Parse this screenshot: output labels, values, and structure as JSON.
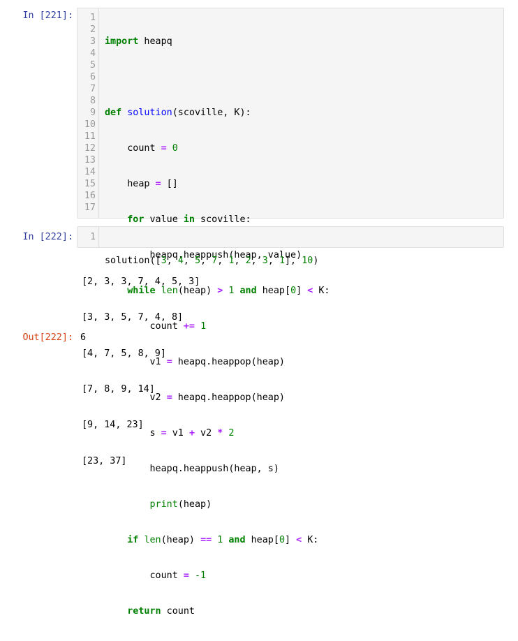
{
  "cell1": {
    "prompt": "In [221]:",
    "line_numbers": [
      "1",
      "2",
      "3",
      "4",
      "5",
      "6",
      "7",
      "8",
      "9",
      "10",
      "11",
      "12",
      "13",
      "14",
      "15",
      "16",
      "17"
    ],
    "tokens": {
      "l1_kw": "import",
      "l1_rest": " heapq",
      "l3_kw": "def",
      "l3_fn": "solution",
      "l3_rest": "(scoville, K):",
      "l4_a": "    count ",
      "l4_op": "=",
      "l4_sp": " ",
      "l4_num": "0",
      "l5_a": "    heap ",
      "l5_op": "=",
      "l5_rest": " []",
      "l6_sp": "    ",
      "l6_kw1": "for",
      "l6_mid": " value ",
      "l6_kw2": "in",
      "l6_rest": " scoville:",
      "l7": "        heapq.heappush(heap, value)",
      "l8_sp": "    ",
      "l8_kw": "while",
      "l8_sp2": " ",
      "l8_bi": "len",
      "l8_a": "(heap) ",
      "l8_op1": ">",
      "l8_sp3": " ",
      "l8_num1": "1",
      "l8_sp4": " ",
      "l8_kw2": "and",
      "l8_b": " heap[",
      "l8_num2": "0",
      "l8_c": "] ",
      "l8_op2": "<",
      "l8_d": " K:",
      "l9_a": "        count ",
      "l9_op": "+=",
      "l9_sp": " ",
      "l9_num": "1",
      "l10_a": "        v1 ",
      "l10_op": "=",
      "l10_rest": " heapq.heappop(heap)",
      "l11_a": "        v2 ",
      "l11_op": "=",
      "l11_rest": " heapq.heappop(heap)",
      "l12_a": "        s ",
      "l12_op1": "=",
      "l12_b": " v1 ",
      "l12_op2": "+",
      "l12_c": " v2 ",
      "l12_op3": "*",
      "l12_sp": " ",
      "l12_num": "2",
      "l13": "        heapq.heappush(heap, s)",
      "l14_sp": "        ",
      "l14_bi": "print",
      "l14_rest": "(heap)",
      "l15_sp": "    ",
      "l15_kw": "if",
      "l15_sp2": " ",
      "l15_bi": "len",
      "l15_a": "(heap) ",
      "l15_op": "==",
      "l15_sp3": " ",
      "l15_num1": "1",
      "l15_sp4": " ",
      "l15_kw2": "and",
      "l15_b": " heap[",
      "l15_num2": "0",
      "l15_c": "] ",
      "l15_op2": "<",
      "l15_d": " K:",
      "l16_a": "        count ",
      "l16_op": "=",
      "l16_sp": " ",
      "l16_num": "-1",
      "l17_sp": "    ",
      "l17_kw": "return",
      "l17_rest": " count"
    }
  },
  "cell2": {
    "prompt": "In [222]:",
    "line_numbers": [
      "1"
    ],
    "tokens": {
      "a": "solution([",
      "n1": "3",
      "c1": ", ",
      "n2": "4",
      "c2": ", ",
      "n3": "5",
      "c3": ", ",
      "n4": "7",
      "c4": ", ",
      "n5": "1",
      "c5": ", ",
      "n6": "2",
      "c6": ", ",
      "n7": "3",
      "c7": ", ",
      "n8": "1",
      "b": "], ",
      "n9": "10",
      "e": ")"
    }
  },
  "stdout": [
    "[2, 3, 3, 7, 4, 5, 3]",
    "[3, 3, 5, 7, 4, 8]",
    "[4, 7, 5, 8, 9]",
    "[7, 8, 9, 14]",
    "[9, 14, 23]",
    "[23, 37]"
  ],
  "result": {
    "prompt": "Out[222]:",
    "value": "6"
  },
  "colors": {
    "in_prompt": "#303f9f",
    "out_prompt": "#d84315",
    "keyword": "#008000",
    "operator": "#aa22ff",
    "function_name": "#0000ff",
    "cell_background": "#f5f5f5"
  }
}
